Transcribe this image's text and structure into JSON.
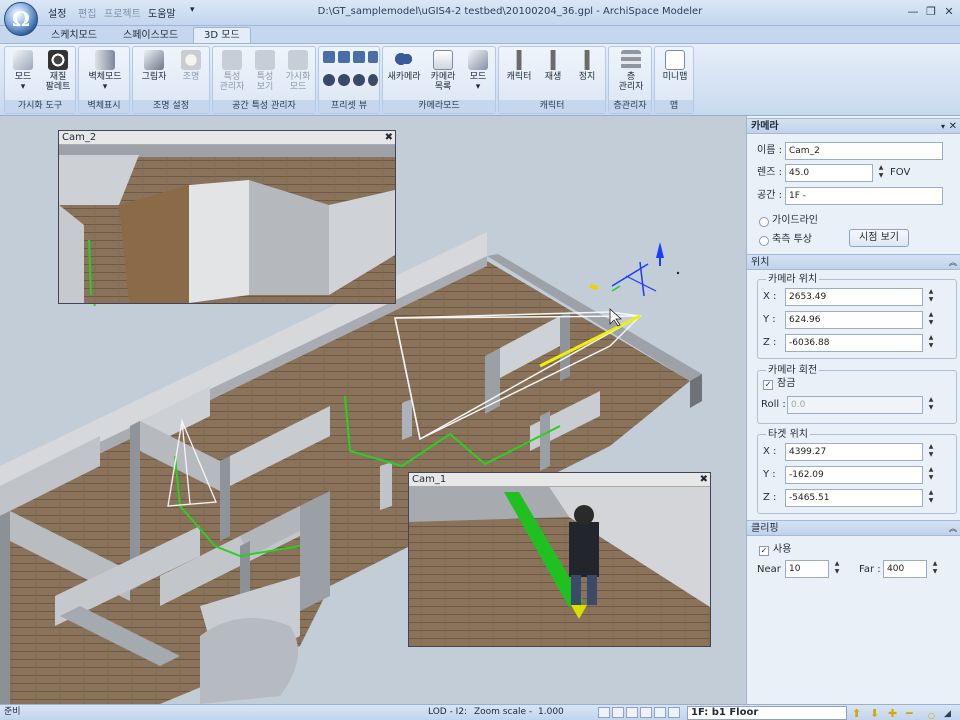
{
  "window": {
    "title": "D:\\GT_samplemodel\\uGIS4-2 testbed\\20100204_36.gpl - ArchiSpace Modeler",
    "quick_menu": [
      "설정",
      "편집",
      "프로젝트",
      "도움말"
    ]
  },
  "tabs": [
    "스케치모드",
    "스페이스모드",
    "3D 모드"
  ],
  "active_tab": "3D 모드",
  "ribbon": {
    "groups": [
      {
        "label": "가시화 도구",
        "buttons": [
          {
            "label": "모드",
            "enabled": true
          },
          {
            "label": "재질\n팔레트",
            "enabled": true
          }
        ]
      },
      {
        "label": "벽체표시",
        "buttons": [
          {
            "label": "벽체모드",
            "enabled": true
          }
        ]
      },
      {
        "label": "조명 설정",
        "buttons": [
          {
            "label": "그림자",
            "enabled": true
          },
          {
            "label": "조명",
            "enabled": false
          }
        ]
      },
      {
        "label": "공간 특성 관리자",
        "buttons": [
          {
            "label": "특성\n관리자",
            "enabled": false
          },
          {
            "label": "특성\n보기",
            "enabled": false
          },
          {
            "label": "가시화\n모드",
            "enabled": false
          }
        ]
      },
      {
        "label": "프리셋 뷰",
        "buttons": []
      },
      {
        "label": "카메라모드",
        "buttons": [
          {
            "label": "새카메라",
            "enabled": true
          },
          {
            "label": "카메라\n목록",
            "enabled": true
          },
          {
            "label": "모드",
            "enabled": true
          }
        ]
      },
      {
        "label": "캐릭터",
        "buttons": [
          {
            "label": "캐릭터",
            "enabled": true
          },
          {
            "label": "재생",
            "enabled": true
          },
          {
            "label": "정지",
            "enabled": true
          }
        ]
      },
      {
        "label": "층관리자",
        "buttons": [
          {
            "label": "층\n관리자",
            "enabled": true
          }
        ]
      },
      {
        "label": "맵",
        "buttons": [
          {
            "label": "미니맵",
            "enabled": true
          }
        ]
      }
    ]
  },
  "viewport": {
    "cam2_title": "Cam_2",
    "cam1_title": "Cam_1"
  },
  "panel": {
    "header": "카메라",
    "name_label": "이름 :",
    "name_value": "Cam_2",
    "lens_label": "렌즈 :",
    "lens_value": "45.0",
    "fov_label": "FOV",
    "space_label": "공간 :",
    "space_value": "1F -",
    "guideline_label": "가이드라인",
    "axis_projection_label": "축측 투상",
    "view_button": "시점 보기",
    "position_header": "위치",
    "camera_position_legend": "카메라 위치",
    "cam_x": "2653.49",
    "cam_y": "624.96",
    "cam_z": "-6036.88",
    "rotation_legend": "카메라 회전",
    "lock_label": "잠금",
    "lock_checked": true,
    "roll_label": "Roll :",
    "roll_value": "0.0",
    "target_legend": "타겟 위치",
    "target_x": "4399.27",
    "target_y": "-162.09",
    "target_z": "-5465.51",
    "clipping_header": "클리핑",
    "use_label": "사용",
    "use_checked": true,
    "near_label": "Near :",
    "near_value": "10",
    "far_label": "Far :",
    "far_value": "400",
    "x_label": "X :",
    "y_label": "Y :",
    "z_label": "Z :"
  },
  "status": {
    "ready": "준비",
    "lod": "LOD - I2:",
    "zoom_label": "Zoom scale -",
    "zoom_value": "1.000",
    "floor": "1F: b1 Floor"
  },
  "colors": {
    "ribbon_bg": "#dbe6f5",
    "accent": "#c3d6ee",
    "path_green": "#28d020",
    "axis_blue": "#1a3cff"
  }
}
